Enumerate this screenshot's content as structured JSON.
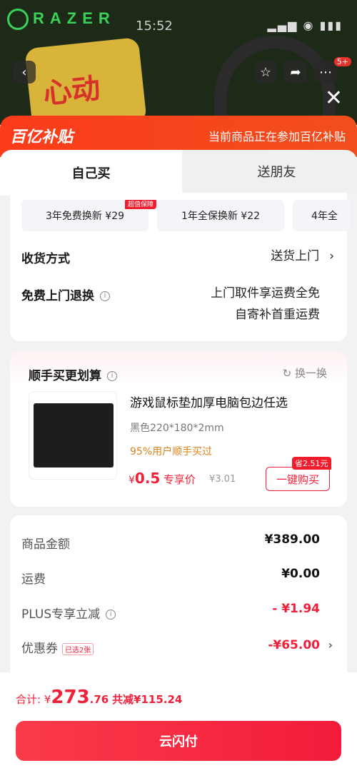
{
  "background": {
    "brand": "RAZER",
    "time": "15:52",
    "promo_text": "心动",
    "cart_badge": "5+"
  },
  "subsidy": {
    "logo": "百亿补贴",
    "note": "当前商品正在参加百亿补贴"
  },
  "tabs": {
    "self": "自己买",
    "friend": "送朋友"
  },
  "services": {
    "tag": "超值保障",
    "items": [
      "3年免费换新 ¥29",
      "1年全保换新 ¥22",
      "4年全"
    ]
  },
  "delivery": {
    "label": "收货方式",
    "value": "送货上门"
  },
  "returns": {
    "label": "免费上门退换",
    "value_line1": "上门取件享运费全免",
    "value_line2": "自寄补首重运费"
  },
  "addon": {
    "title": "顺手买更划算",
    "swap": "换一换",
    "product_name": "游戏鼠标垫加厚电脑包边任选",
    "spec": "黑色220*180*2mm",
    "percent": "95%用户顺手买过",
    "currency": "¥",
    "price": "0.5",
    "price_note": "专享价",
    "original_price": "¥3.01",
    "save_tag": "省2.51元",
    "buy_label": "一键购买"
  },
  "summary": {
    "goods_label": "商品金额",
    "goods_value": "¥389.00",
    "shipping_label": "运费",
    "shipping_value": "¥0.00",
    "plus_label": "PLUS专享立减",
    "plus_value": "- ¥1.94",
    "coupon_label": "优惠券",
    "coupon_tag": "已选2张",
    "coupon_value": "-¥65.00"
  },
  "footer": {
    "total_prefix": "合计: ¥",
    "total_int": "273",
    "total_dec": ".76",
    "reduce": "共减¥115.24",
    "pay_label": "云闪付"
  },
  "colors": {
    "accent": "#f0203a",
    "subsidy": "#fb3b1a"
  }
}
